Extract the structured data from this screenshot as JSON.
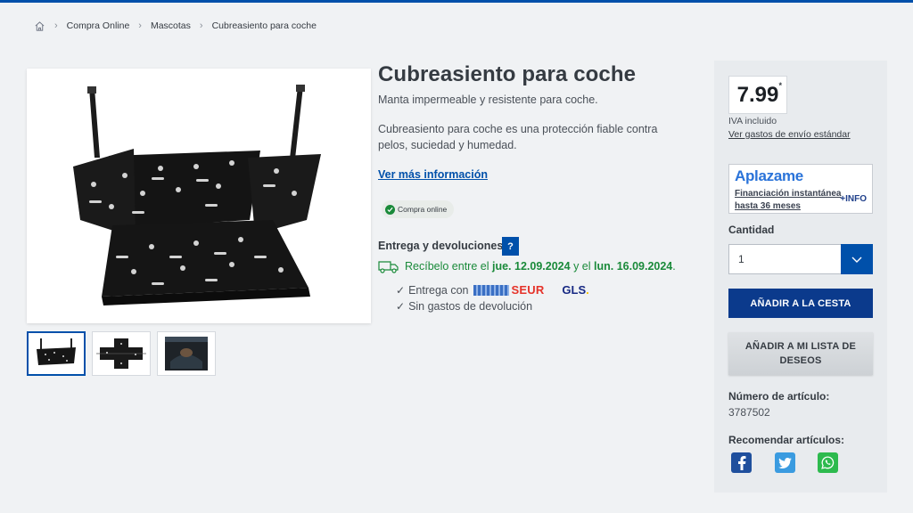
{
  "breadcrumb": {
    "items": [
      "Compra Online",
      "Mascotas",
      "Cubreasiento para coche"
    ]
  },
  "product": {
    "title": "Cubreasiento para coche",
    "subtitle": "Manta impermeable y resistente para coche.",
    "description": "Cubreasiento para coche es una protección fiable contra pelos, suciedad y humedad.",
    "more_link": "Ver más información",
    "badge": "Compra online"
  },
  "delivery": {
    "label": "Entrega y devoluciones:",
    "help": "?",
    "date_prefix": "Recíbelo entre el",
    "date_from": "jue. 12.09.2024",
    "date_mid": "y el",
    "date_to": "lun. 16.09.2024",
    "date_suffix": ".",
    "carrier_prefix": "Entrega con",
    "carrier1": "SEUR",
    "carrier2": "GLS",
    "carrier2_dot": ".",
    "no_return_cost": "Sin gastos de devolución",
    "tick": "✓"
  },
  "panel": {
    "price": "7.99",
    "price_mark": "*",
    "iva": "IVA incluido",
    "shipping_link": "Ver gastos de envío estándar",
    "aplazame_logo": "Aplazame",
    "aplazame_text": "Financiación instantánea hasta 36 meses",
    "aplazame_info": "+INFO",
    "qty_label": "Cantidad",
    "qty_value": "1",
    "add_to_cart": "AÑADIR A LA CESTA",
    "add_to_wishlist": "AÑADIR A MI LISTA DE DESEOS",
    "article_label": "Número de artículo:",
    "article_number": "3787502",
    "recommend_label": "Recomendar artículos:"
  },
  "colors": {
    "brand_blue": "#0050aa",
    "cart_button": "#0b3a8c",
    "success_green": "#1a8a3a"
  }
}
